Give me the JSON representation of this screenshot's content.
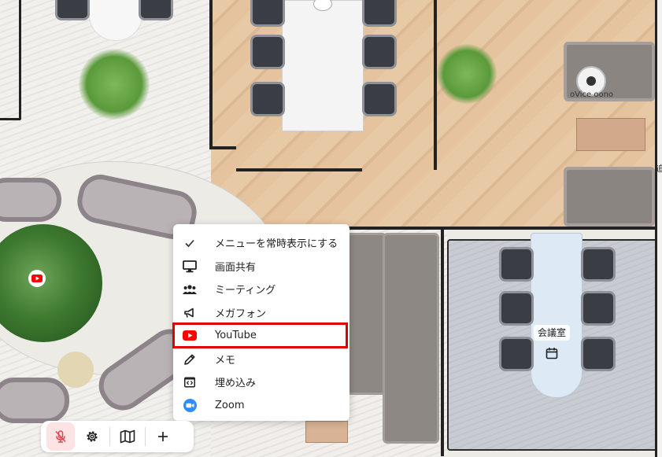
{
  "menu": {
    "items": [
      {
        "label": "メニューを常時表示にする",
        "icon": "check-icon"
      },
      {
        "label": "画面共有",
        "icon": "monitor-icon"
      },
      {
        "label": "ミーティング",
        "icon": "people-icon"
      },
      {
        "label": "メガフォン",
        "icon": "megaphone-icon"
      },
      {
        "label": "YouTube",
        "icon": "youtube-icon"
      },
      {
        "label": "メモ",
        "icon": "pencil-icon"
      },
      {
        "label": "埋め込み",
        "icon": "embed-icon"
      },
      {
        "label": "Zoom",
        "icon": "zoom-icon"
      }
    ],
    "highlighted": "YouTube"
  },
  "map": {
    "user_name": "oVice oono",
    "meeting_room_label": "会議室",
    "side_cut_text": "追"
  },
  "toolbar": {
    "buttons": [
      "mic-muted-icon",
      "gear-icon",
      "map-icon",
      "plus-icon"
    ]
  },
  "colors": {
    "highlight": "#e00000",
    "youtube": "#ff0000",
    "zoom": "#2d8cff",
    "mic_muted_bg": "#fde3e3",
    "mic_muted": "#e0454f"
  }
}
